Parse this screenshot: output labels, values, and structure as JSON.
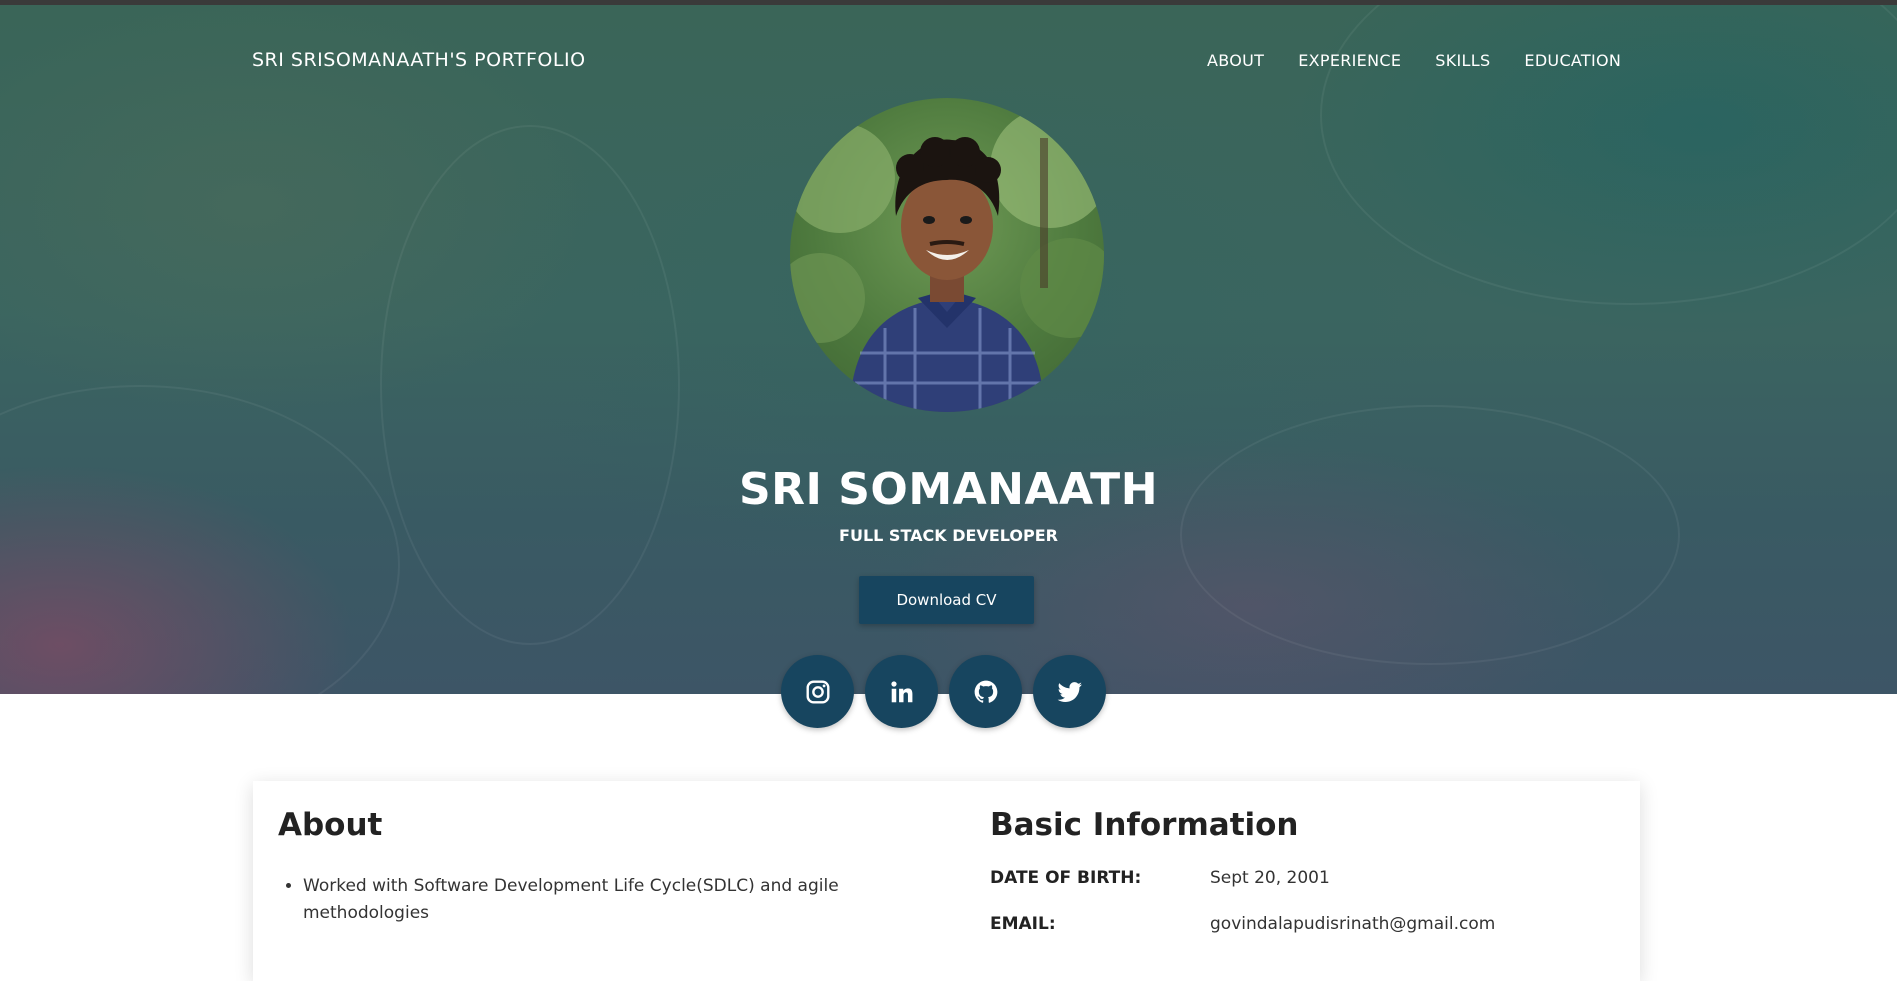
{
  "header": {
    "brand": "SRI SRISOMANAATH'S PORTFOLIO",
    "nav": [
      "ABOUT",
      "EXPERIENCE",
      "SKILLS",
      "EDUCATION"
    ]
  },
  "hero": {
    "name": "SRI SOMANAATH",
    "role": "FULL STACK DEVELOPER",
    "cv_button": "Download CV",
    "socials": [
      "instagram-icon",
      "linkedin-icon",
      "github-icon",
      "twitter-icon"
    ]
  },
  "about": {
    "title": "About",
    "items": [
      "Worked with Software Development Life Cycle(SDLC) and agile methodologies"
    ]
  },
  "basic_info": {
    "title": "Basic Information",
    "rows": [
      {
        "label": "DATE OF BIRTH:",
        "value": "Sept 20, 2001"
      },
      {
        "label": "EMAIL:",
        "value": "govindalapudisrinath@gmail.com"
      }
    ]
  },
  "colors": {
    "accent": "#17455f",
    "hero_base": "#3b6560"
  }
}
